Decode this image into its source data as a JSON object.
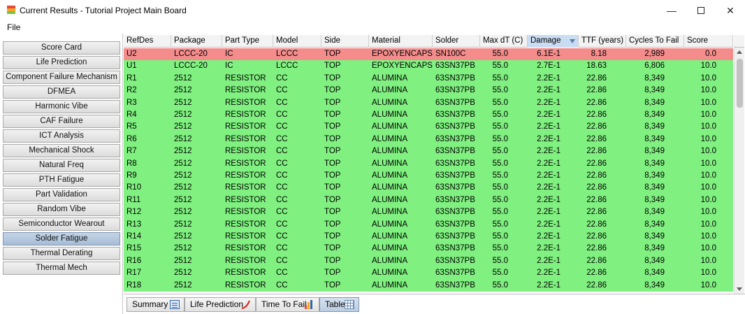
{
  "window": {
    "title": "Current Results - Tutorial Project Main Board",
    "minimize": "—",
    "close": "✕"
  },
  "menu": {
    "file": "File"
  },
  "sidebar": {
    "items": [
      "Score Card",
      "Life Prediction",
      "Component Failure Mechanism",
      "DFMEA",
      "Harmonic Vibe",
      "CAF Failure",
      "ICT Analysis",
      "Mechanical Shock",
      "Natural Freq",
      "PTH Fatigue",
      "Part Validation",
      "Random Vibe",
      "Semiconductor Wearout",
      "Solder Fatigue",
      "Thermal Derating",
      "Thermal Mech"
    ],
    "selected_index": 13
  },
  "table": {
    "columns": [
      "RefDes",
      "Package",
      "Part Type",
      "Model",
      "Side",
      "Material",
      "Solder",
      "Max dT (C)",
      "Damage",
      "TTF (years)",
      "Cycles To Fail",
      "Score"
    ],
    "sorted_column_index": 8,
    "row_colors": {
      "fail": "#f58c8c",
      "pass": "#80f080"
    },
    "rows": [
      {
        "status": "fail",
        "cells": [
          "U2",
          "LCCC-20",
          "IC",
          "LCCC",
          "TOP",
          "EPOXYENCAPS...",
          "SN100C",
          "55.0",
          "6.1E-1",
          "8.18",
          "2,989",
          "0.0"
        ]
      },
      {
        "status": "pass",
        "cells": [
          "U1",
          "LCCC-20",
          "IC",
          "LCCC",
          "TOP",
          "EPOXYENCAPS...",
          "63SN37PB",
          "55.0",
          "2.7E-1",
          "18.63",
          "6,806",
          "10.0"
        ]
      },
      {
        "status": "pass",
        "cells": [
          "R1",
          "2512",
          "RESISTOR",
          "CC",
          "TOP",
          "ALUMINA",
          "63SN37PB",
          "55.0",
          "2.2E-1",
          "22.86",
          "8,349",
          "10.0"
        ]
      },
      {
        "status": "pass",
        "cells": [
          "R2",
          "2512",
          "RESISTOR",
          "CC",
          "TOP",
          "ALUMINA",
          "63SN37PB",
          "55.0",
          "2.2E-1",
          "22.86",
          "8,349",
          "10.0"
        ]
      },
      {
        "status": "pass",
        "cells": [
          "R3",
          "2512",
          "RESISTOR",
          "CC",
          "TOP",
          "ALUMINA",
          "63SN37PB",
          "55.0",
          "2.2E-1",
          "22.86",
          "8,349",
          "10.0"
        ]
      },
      {
        "status": "pass",
        "cells": [
          "R4",
          "2512",
          "RESISTOR",
          "CC",
          "TOP",
          "ALUMINA",
          "63SN37PB",
          "55.0",
          "2.2E-1",
          "22.86",
          "8,349",
          "10.0"
        ]
      },
      {
        "status": "pass",
        "cells": [
          "R5",
          "2512",
          "RESISTOR",
          "CC",
          "TOP",
          "ALUMINA",
          "63SN37PB",
          "55.0",
          "2.2E-1",
          "22.86",
          "8,349",
          "10.0"
        ]
      },
      {
        "status": "pass",
        "cells": [
          "R6",
          "2512",
          "RESISTOR",
          "CC",
          "TOP",
          "ALUMINA",
          "63SN37PB",
          "55.0",
          "2.2E-1",
          "22.86",
          "8,349",
          "10.0"
        ]
      },
      {
        "status": "pass",
        "cells": [
          "R7",
          "2512",
          "RESISTOR",
          "CC",
          "TOP",
          "ALUMINA",
          "63SN37PB",
          "55.0",
          "2.2E-1",
          "22.86",
          "8,349",
          "10.0"
        ]
      },
      {
        "status": "pass",
        "cells": [
          "R8",
          "2512",
          "RESISTOR",
          "CC",
          "TOP",
          "ALUMINA",
          "63SN37PB",
          "55.0",
          "2.2E-1",
          "22.86",
          "8,349",
          "10.0"
        ]
      },
      {
        "status": "pass",
        "cells": [
          "R9",
          "2512",
          "RESISTOR",
          "CC",
          "TOP",
          "ALUMINA",
          "63SN37PB",
          "55.0",
          "2.2E-1",
          "22.86",
          "8,349",
          "10.0"
        ]
      },
      {
        "status": "pass",
        "cells": [
          "R10",
          "2512",
          "RESISTOR",
          "CC",
          "TOP",
          "ALUMINA",
          "63SN37PB",
          "55.0",
          "2.2E-1",
          "22.86",
          "8,349",
          "10.0"
        ]
      },
      {
        "status": "pass",
        "cells": [
          "R11",
          "2512",
          "RESISTOR",
          "CC",
          "TOP",
          "ALUMINA",
          "63SN37PB",
          "55.0",
          "2.2E-1",
          "22.86",
          "8,349",
          "10.0"
        ]
      },
      {
        "status": "pass",
        "cells": [
          "R12",
          "2512",
          "RESISTOR",
          "CC",
          "TOP",
          "ALUMINA",
          "63SN37PB",
          "55.0",
          "2.2E-1",
          "22.86",
          "8,349",
          "10.0"
        ]
      },
      {
        "status": "pass",
        "cells": [
          "R13",
          "2512",
          "RESISTOR",
          "CC",
          "TOP",
          "ALUMINA",
          "63SN37PB",
          "55.0",
          "2.2E-1",
          "22.86",
          "8,349",
          "10.0"
        ]
      },
      {
        "status": "pass",
        "cells": [
          "R14",
          "2512",
          "RESISTOR",
          "CC",
          "TOP",
          "ALUMINA",
          "63SN37PB",
          "55.0",
          "2.2E-1",
          "22.86",
          "8,349",
          "10.0"
        ]
      },
      {
        "status": "pass",
        "cells": [
          "R15",
          "2512",
          "RESISTOR",
          "CC",
          "TOP",
          "ALUMINA",
          "63SN37PB",
          "55.0",
          "2.2E-1",
          "22.86",
          "8,349",
          "10.0"
        ]
      },
      {
        "status": "pass",
        "cells": [
          "R16",
          "2512",
          "RESISTOR",
          "CC",
          "TOP",
          "ALUMINA",
          "63SN37PB",
          "55.0",
          "2.2E-1",
          "22.86",
          "8,349",
          "10.0"
        ]
      },
      {
        "status": "pass",
        "cells": [
          "R17",
          "2512",
          "RESISTOR",
          "CC",
          "TOP",
          "ALUMINA",
          "63SN37PB",
          "55.0",
          "2.2E-1",
          "22.86",
          "8,349",
          "10.0"
        ]
      },
      {
        "status": "pass",
        "cells": [
          "R18",
          "2512",
          "RESISTOR",
          "CC",
          "TOP",
          "ALUMINA",
          "63SN37PB",
          "55.0",
          "2.2E-1",
          "22.86",
          "8,349",
          "10.0"
        ]
      }
    ]
  },
  "tabs": [
    {
      "label": "Summary",
      "icon": "summary-icon",
      "active": false
    },
    {
      "label": "Life Prediction",
      "icon": "curve-icon",
      "active": false
    },
    {
      "label": "Time To Fail",
      "icon": "bar-chart-icon",
      "active": false
    },
    {
      "label": "Table",
      "icon": "table-icon",
      "active": true
    }
  ]
}
